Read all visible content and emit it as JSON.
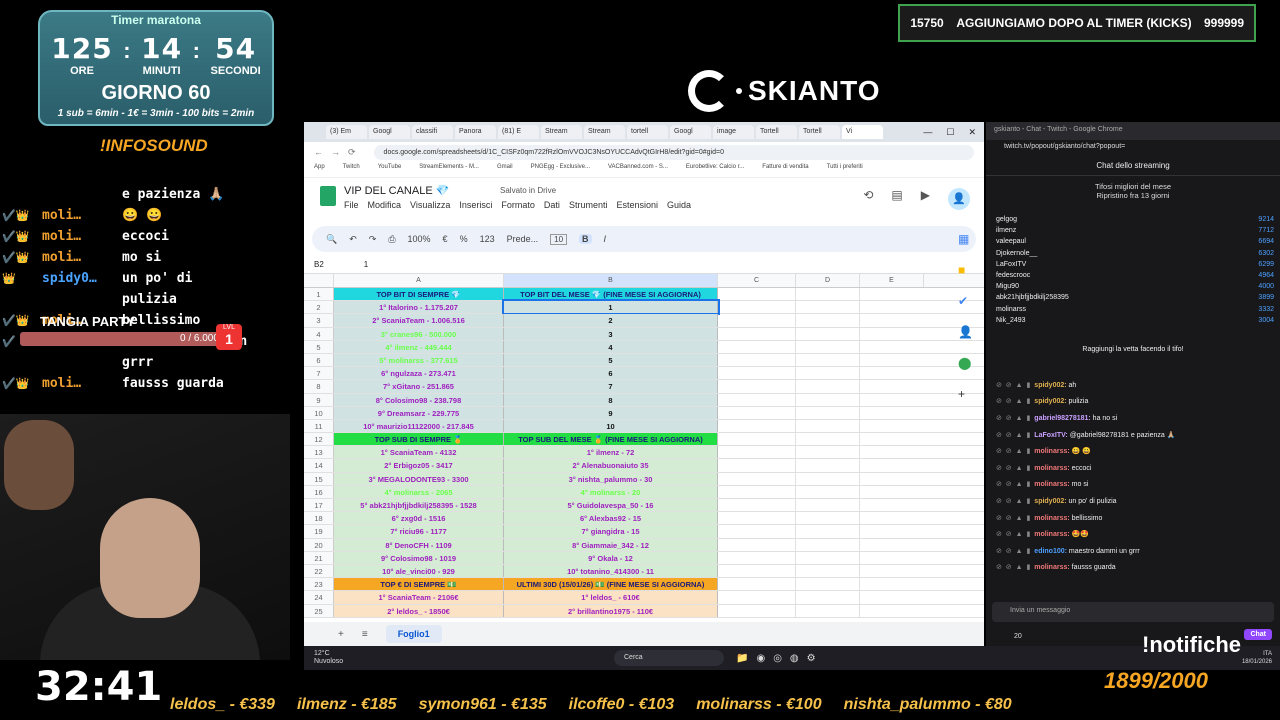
{
  "timer": {
    "title": "Timer maratona",
    "hours": "125",
    "hours_label": "ORE",
    "minutes": "14",
    "minutes_label": "MINUTI",
    "seconds": "54",
    "seconds_label": "SECONDI",
    "day": "GIORNO 60",
    "rates": "1 sub = 6min - 1€ = 3min - 100 bits = 2min"
  },
  "infosound": "!INFOSOUND",
  "left_chat": [
    {
      "badges": "",
      "user": "",
      "msg": "e pazienza 🙏🏼",
      "c": ""
    },
    {
      "badges": "✔️👑",
      "user": "moli…",
      "msg": "😀 😀",
      "c": ""
    },
    {
      "badges": "✔️👑",
      "user": "moli…",
      "msg": "eccoci",
      "c": ""
    },
    {
      "badges": "✔️👑",
      "user": "moli…",
      "msg": "mo si",
      "c": ""
    },
    {
      "badges": "👑",
      "user": "spidy0…",
      "msg": "un po' di\npulizia",
      "c": "c2"
    },
    {
      "badges": "✔️👑",
      "user": "moli…",
      "msg": "bellissimo",
      "c": ""
    },
    {
      "badges": "✔️",
      "user": "edino1…",
      "msg": "maestro dammi un\ngrrr",
      "c": "c2"
    },
    {
      "badges": "✔️👑",
      "user": "moli…",
      "msg": "fausss guarda",
      "c": ""
    }
  ],
  "tangia": {
    "label": "TANGIA PARTY",
    "count": "0 / 6.000",
    "lvl_label": "LVL",
    "lvl": "1"
  },
  "clock": "32:41",
  "kicks": {
    "left": "15750",
    "text": "AGGIUNGIAMO DOPO AL TIMER (KICKS)",
    "right": "999999"
  },
  "logo": {
    "name": "SKIANTO"
  },
  "browser": {
    "tabs": [
      "(3) Em",
      "Googl",
      "classifi",
      "Panora",
      "(81) E",
      "Stream",
      "Stream",
      "tortell",
      "Googl",
      "image",
      "Tortell",
      "Tortell",
      "Vi"
    ],
    "url": "docs.google.com/spreadsheets/d/1C_CISFz0qm722fRzlOmVVOJC3NsOYUCCAdvQtGIrH8/edit?gid=0#gid=0",
    "bookmarks": [
      "App",
      "Twitch",
      "YouTube",
      "StreamElements - M...",
      "Gmail",
      "PNGEgg - Exclusive...",
      "VACBanned.com - S...",
      "Eurobetlive: Calcio r...",
      "Fatture di vendita",
      "Tutti i preferiti"
    ],
    "doc_title": "VIP DEL CANALE 💎",
    "saved": "Salvato in Drive",
    "menus": [
      "File",
      "Modifica",
      "Visualizza",
      "Inserisci",
      "Formato",
      "Dati",
      "Strumenti",
      "Estensioni",
      "Guida"
    ],
    "toolbar": {
      "zoom": "100%",
      "currency": "€",
      "percent": "%",
      "format": "123",
      "font": "Prede...",
      "size": "10",
      "bold": "B",
      "italic": "I"
    },
    "cell_ref": "B2",
    "formula": "1",
    "columns": [
      "A",
      "B",
      "C",
      "D",
      "E"
    ],
    "sheet_tab": "Foglio1"
  },
  "sheet_rows": [
    {
      "n": "1",
      "a": "TOP BIT DI SEMPRE 💎",
      "b": "TOP BIT DEL MESE 💎 (FINE MESE SI AGGIORNA)",
      "bg_a": "#20d7e0",
      "bg_b": "#20d7e0",
      "col": "#1a1a7a"
    },
    {
      "n": "2",
      "a": "1° Italorino - 1.175.207",
      "b": "1",
      "bg_a": "#d0e3e2",
      "bg_b": "#d0e3e2",
      "col": "#a020c0"
    },
    {
      "n": "3",
      "a": "2° ScaniaTeam - 1.006.516",
      "b": "2",
      "bg_a": "#d0e3e2",
      "bg_b": "#d0e3e2",
      "col": "#a020c0"
    },
    {
      "n": "4",
      "a": "3° cranes96 - 500.000",
      "b": "3",
      "bg_a": "#d0e3e2",
      "bg_b": "#d0e3e2",
      "col": "#6aff4a"
    },
    {
      "n": "5",
      "a": "4° ilmenz - 449.444",
      "b": "4",
      "bg_a": "#d0e3e2",
      "bg_b": "#d0e3e2",
      "col": "#6aff4a"
    },
    {
      "n": "6",
      "a": "5° molinarss - 377.615",
      "b": "5",
      "bg_a": "#d0e3e2",
      "bg_b": "#d0e3e2",
      "col": "#6aff4a"
    },
    {
      "n": "7",
      "a": "6° ngulzaza - 273.471",
      "b": "6",
      "bg_a": "#d0e3e2",
      "bg_b": "#d0e3e2",
      "col": "#a020c0"
    },
    {
      "n": "8",
      "a": "7° xGitano - 251.865",
      "b": "7",
      "bg_a": "#d0e3e2",
      "bg_b": "#d0e3e2",
      "col": "#a020c0"
    },
    {
      "n": "9",
      "a": "8° Colosimo98 - 238.798",
      "b": "8",
      "bg_a": "#d0e3e2",
      "bg_b": "#d0e3e2",
      "col": "#a020c0"
    },
    {
      "n": "10",
      "a": "9° Dreamsarz - 229.775",
      "b": "9",
      "bg_a": "#d0e3e2",
      "bg_b": "#d0e3e2",
      "col": "#a020c0"
    },
    {
      "n": "11",
      "a": "10° maurizio11122000 - 217.845",
      "b": "10",
      "bg_a": "#d0e3e2",
      "bg_b": "#d0e3e2",
      "col": "#a020c0"
    },
    {
      "n": "12",
      "a": "TOP SUB DI SEMPRE 🏅",
      "b": "TOP SUB DEL MESE 🏅 (FINE MESE SI AGGIORNA)",
      "bg_a": "#22dd44",
      "bg_b": "#22dd44",
      "col": "#1a1a7a"
    },
    {
      "n": "13",
      "a": "1° ScaniaTeam - 4132",
      "b": "1° ilmenz - 72",
      "bg_a": "#d4ecd4",
      "bg_b": "#d4ecd4",
      "col": "#a020c0"
    },
    {
      "n": "14",
      "a": "2° Erbigoz05 - 3417",
      "b": "2° Alenabuonaiuto 35",
      "bg_a": "#d4ecd4",
      "bg_b": "#d4ecd4",
      "col": "#a020c0"
    },
    {
      "n": "15",
      "a": "3° MEGALODONTE93 - 3300",
      "b": "3° nishta_palummo - 30",
      "bg_a": "#d4ecd4",
      "bg_b": "#d4ecd4",
      "col": "#a020c0"
    },
    {
      "n": "16",
      "a": "4° molinarss - 2065",
      "b": "4° molinarss - 20",
      "bg_a": "#d4ecd4",
      "bg_b": "#d4ecd4",
      "col": "#6aff4a"
    },
    {
      "n": "17",
      "a": "5° abk21hjbfjjbdkilj258395 - 1528",
      "b": "5° Guidolavespa_50 - 16",
      "bg_a": "#d4ecd4",
      "bg_b": "#d4ecd4",
      "col": "#a020c0"
    },
    {
      "n": "18",
      "a": "6° zxg0d - 1516",
      "b": "6° Alexbas92 - 15",
      "bg_a": "#d4ecd4",
      "bg_b": "#d4ecd4",
      "col": "#a020c0"
    },
    {
      "n": "19",
      "a": "7° riciu96 - 1177",
      "b": "7° giangidra - 15",
      "bg_a": "#d4ecd4",
      "bg_b": "#d4ecd4",
      "col": "#a020c0"
    },
    {
      "n": "20",
      "a": "8° DenoCFH - 1109",
      "b": "8° Giammaie_342 - 12",
      "bg_a": "#d4ecd4",
      "bg_b": "#d4ecd4",
      "col": "#a020c0"
    },
    {
      "n": "21",
      "a": "9° Colosimo98 - 1019",
      "b": "9° Okala - 12",
      "bg_a": "#d4ecd4",
      "bg_b": "#d4ecd4",
      "col": "#a020c0"
    },
    {
      "n": "22",
      "a": "10° ale_vinci00 - 929",
      "b": "10° totanino_414300 - 11",
      "bg_a": "#d4ecd4",
      "bg_b": "#d4ecd4",
      "col": "#a020c0"
    },
    {
      "n": "23",
      "a": "TOP € DI SEMPRE 💵",
      "b": "ULTIMI 30D (15/01/26) 💵 (FINE MESE SI AGGIORNA)",
      "bg_a": "#f5a623",
      "bg_b": "#f5a623",
      "col": "#1a1a7a"
    },
    {
      "n": "24",
      "a": "1° ScaniaTeam - 2106€",
      "b": "1° leldos_ - 610€",
      "bg_a": "#fbe2c4",
      "bg_b": "#fbe2c4",
      "col": "#a020c0"
    },
    {
      "n": "25",
      "a": "2° leldos_ - 1850€",
      "b": "2° brillantino1975 - 110€",
      "bg_a": "#fbe2c4",
      "bg_b": "#fbe2c4",
      "col": "#a020c0"
    }
  ],
  "twitch": {
    "tab_title": "gskianto - Chat - Twitch - Google Chrome",
    "url": "twitch.tv/popout/gskianto/chat?popout=",
    "title": "Chat dello streaming",
    "tifosi_title": "Tifosi migliori del mese",
    "tifosi_sub": "Ripristino fra 13 giorni",
    "leaders": [
      {
        "n": "gelgog",
        "s": "9214"
      },
      {
        "n": "ilmenz",
        "s": "7712"
      },
      {
        "n": "valeepaul",
        "s": "6694"
      },
      {
        "n": "Djokernole__",
        "s": "6302"
      },
      {
        "n": "LaFoxITV",
        "s": "6299"
      },
      {
        "n": "fedescrooc",
        "s": "4964"
      },
      {
        "n": "Migu90",
        "s": "4000"
      },
      {
        "n": "abk21hjbfjjbdkilj258395",
        "s": "3899"
      },
      {
        "n": "molinarss",
        "s": "3332"
      },
      {
        "n": "Nik_2493",
        "s": "3004"
      }
    ],
    "reach": "Raggiungi la vetta facendo il tifo!",
    "messages": [
      {
        "u": "spidy002:",
        "m": " ah",
        "c": "#e0b050"
      },
      {
        "u": "spidy002:",
        "m": " pulizia",
        "c": "#e0b050"
      },
      {
        "u": "gabriel98278181:",
        "m": " ha no si",
        "c": "#c9a0ff"
      },
      {
        "u": "LaFoxITV:",
        "m": " @gabriel98278181 e pazienza 🙏🏼",
        "c": "#c9a0ff"
      },
      {
        "u": "molinarss:",
        "m": " 😀 😀",
        "c": "#f07878"
      },
      {
        "u": "molinarss:",
        "m": " eccoci",
        "c": "#f07878"
      },
      {
        "u": "molinarss:",
        "m": " mo si",
        "c": "#f07878"
      },
      {
        "u": "spidy002:",
        "m": " un po' di pulizia",
        "c": "#e0b050"
      },
      {
        "u": "molinarss:",
        "m": " bellissimo",
        "c": "#f07878"
      },
      {
        "u": "molinarss:",
        "m": " 🤩🤩",
        "c": "#f07878"
      },
      {
        "u": "edino100:",
        "m": " maestro dammi un grrr",
        "c": "#4da0ff"
      },
      {
        "u": "molinarss:",
        "m": " fausss guarda",
        "c": "#f07878"
      }
    ],
    "input_placeholder": "Invia un messaggio",
    "points": "20",
    "chat_button": "Chat"
  },
  "taskbar": {
    "temp": "12°C",
    "weather": "Nuvoloso",
    "search": "Cerca",
    "lang": "ITA",
    "date": "18/01/2026"
  },
  "notifiche": "!notifiche",
  "goal": "1899/2000",
  "ticker": [
    "leldos_ - €339",
    "ilmenz - €185",
    "symon961 - €135",
    "ilcoffe0 - €103",
    "molinarss - €100",
    "nishta_palummo - €80"
  ]
}
